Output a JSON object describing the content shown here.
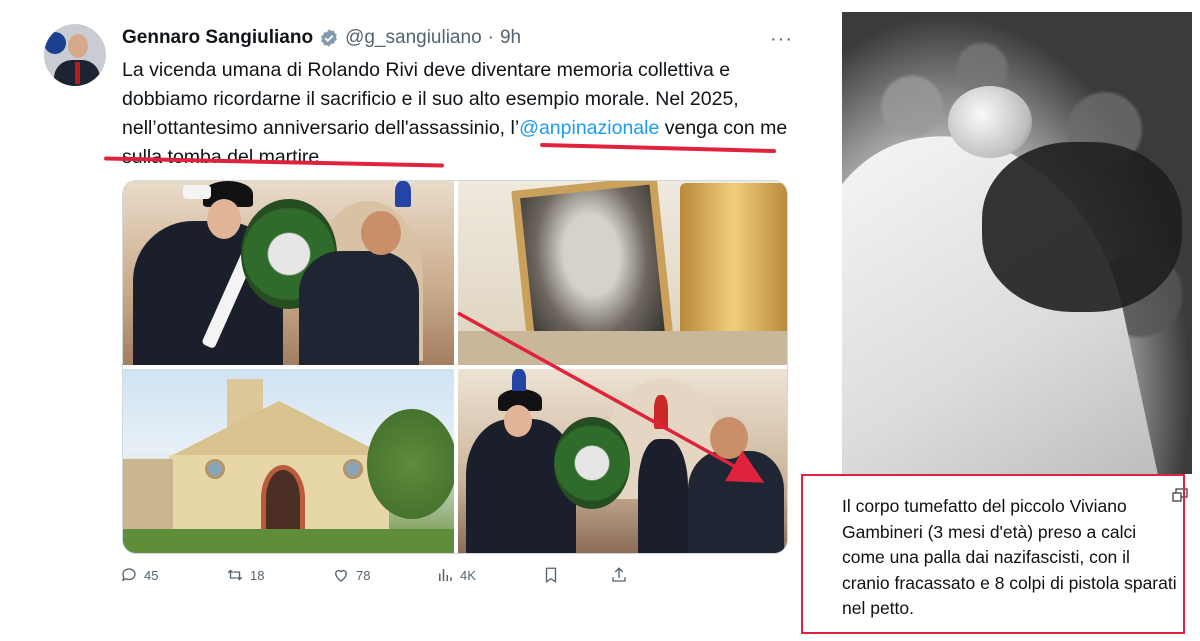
{
  "tweet": {
    "author_name": "Gennaro Sangiuliano",
    "handle": "@g_sangiuliano",
    "separator": "·",
    "time": "9h",
    "text_before_mention": "La vicenda umana di Rolando Rivi deve diventare memoria collettiva e dobbiamo ricordarne il sacrificio e il suo alto esempio morale. Nel 2025, nell’ottantesimo anniversario dell'assassinio, l’",
    "mention": "@anpinazionale",
    "text_after_mention": " venga con me sulla tomba del martire.",
    "more_label": "···",
    "stats": {
      "replies": "45",
      "retweets": "18",
      "likes": "78",
      "views": "4K"
    },
    "icons": {
      "verified": "verified-badge-icon",
      "reply": "reply-icon",
      "retweet": "retweet-icon",
      "like": "heart-icon",
      "views": "views-icon",
      "bookmark": "bookmark-icon",
      "share": "share-icon"
    },
    "colors": {
      "mention": "#1d9bf0",
      "muted": "#536471",
      "annotation_red": "#e0233c"
    }
  },
  "side_panel": {
    "caption": "Il corpo tumefatto del piccolo Viviano Gambineri (3 mesi d'età) preso a calci come una palla dai nazifascisti, con il cranio fracassato e 8 colpi di pistola sparati nel petto."
  }
}
